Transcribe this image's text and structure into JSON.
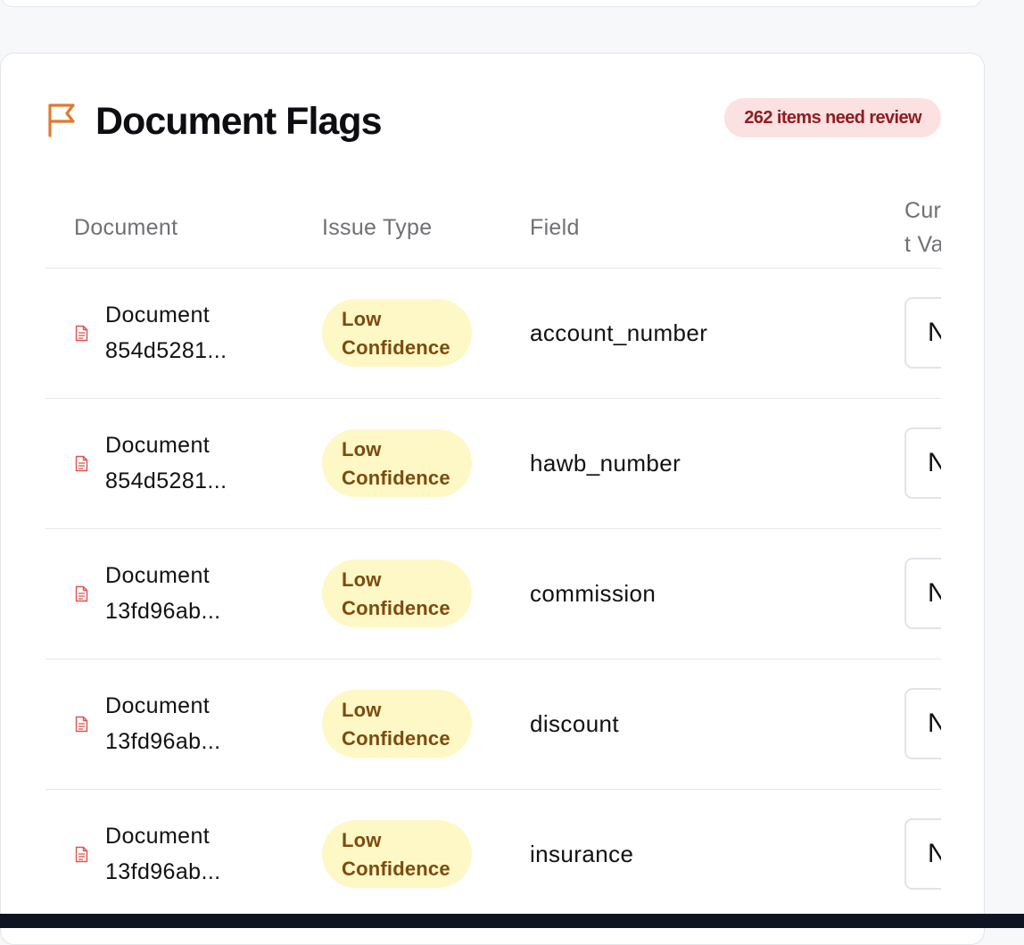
{
  "panel": {
    "title": "Document Flags",
    "review_badge": "262 items need review"
  },
  "icons": {
    "panel_icon": "flag-icon",
    "row_icon": "document-icon"
  },
  "colors": {
    "flag_icon": "#e07a2e",
    "document_icon": "#e0524d",
    "review_badge_bg": "#fbe1e1",
    "review_badge_text": "#8e1d22",
    "issue_badge_bg": "#fdf8c5",
    "issue_badge_text": "#7c4b10"
  },
  "table": {
    "columns": [
      "Document",
      "Issue Type",
      "Field",
      "Current Value"
    ],
    "rows": [
      {
        "document": "Document 854d5281...",
        "issue_type": "Low Confidence",
        "field": "account_number",
        "current_value": "N"
      },
      {
        "document": "Document 854d5281...",
        "issue_type": "Low Confidence",
        "field": "hawb_number",
        "current_value": "N"
      },
      {
        "document": "Document 13fd96ab...",
        "issue_type": "Low Confidence",
        "field": "commission",
        "current_value": "N"
      },
      {
        "document": "Document 13fd96ab...",
        "issue_type": "Low Confidence",
        "field": "discount",
        "current_value": "N"
      },
      {
        "document": "Document 13fd96ab...",
        "issue_type": "Low Confidence",
        "field": "insurance",
        "current_value": "N"
      }
    ]
  }
}
